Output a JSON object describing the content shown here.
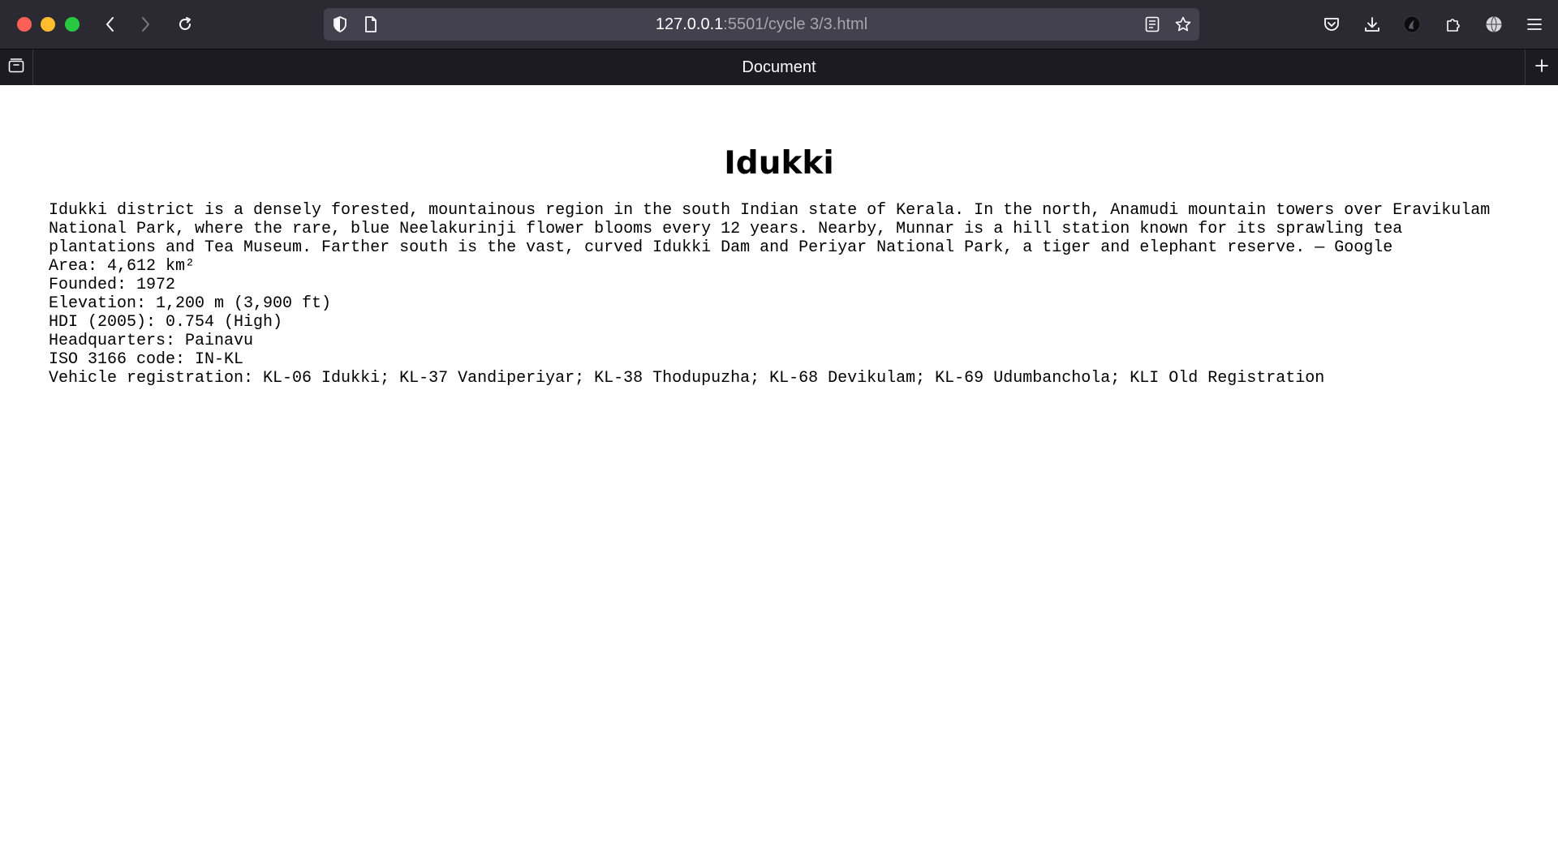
{
  "browser": {
    "url_host": "127.0.0.1",
    "url_path": ":5501/cycle 3/3.html",
    "tab_title": "Document"
  },
  "page": {
    "heading": "Idukki",
    "description": "Idukki district is a densely forested, mountainous region in the south Indian state of Kerala. In the north, Anamudi mountain towers over Eravikulam National Park, where the rare, blue Neelakurinji flower blooms every 12 years. Nearby, Munnar is a hill station known for its sprawling tea plantations and Tea Museum. Farther south is the vast, curved Idukki Dam and Periyar National Park, a tiger and elephant reserve. — Google",
    "facts": [
      "Area: 4,612 km²",
      "Founded: 1972",
      "Elevation: 1,200 m (3,900 ft)",
      "HDI (2005): 0.754 (High)",
      "Headquarters: Painavu",
      "ISO 3166 code: IN-KL",
      "Vehicle registration: KL-06 Idukki; KL-37 Vandiperiyar; KL-38 Thodupuzha; KL-68 Devikulam; KL-69 Udumbanchola; KLI Old Registration"
    ]
  },
  "colors": {
    "chrome_bg": "#2b2a33",
    "tab_strip_bg": "#1c1b22",
    "url_bar_bg": "#42414d",
    "page_bg": "#ffffff"
  }
}
